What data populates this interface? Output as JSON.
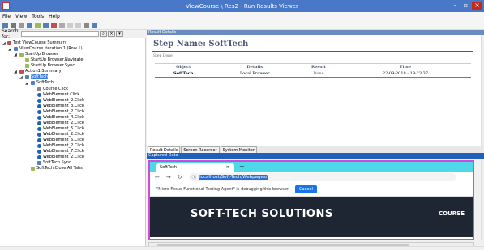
{
  "window": {
    "title": "ViewCourse \\ Res2 - Run Results Viewer"
  },
  "menu": [
    "File",
    "View",
    "Tools",
    "Help"
  ],
  "search": {
    "label": "Search for:"
  },
  "tree": [
    {
      "label": "Test ViewCourse Summary",
      "icon": "summary-icon",
      "color": "#c0504d"
    },
    {
      "label": "ViewCourse Iteration 1 (Row 1)",
      "icon": "iteration-icon",
      "color": "#4f81bd"
    },
    {
      "label": "StartUp Browser",
      "icon": "action-icon",
      "color": "#9bbb59"
    },
    {
      "label": "StartUp Browser.Navigate",
      "icon": "step-icon",
      "color": "#9bbb59"
    },
    {
      "label": "StartUp Browser.Sync",
      "icon": "step-icon",
      "color": "#9bbb59"
    },
    {
      "label": "Action1 Summary",
      "icon": "action-icon",
      "color": "#c0504d"
    },
    {
      "label": "SoftTech",
      "icon": "browser-icon",
      "color": "#4f81bd"
    },
    {
      "label": "SoftTech",
      "icon": "page-icon",
      "color": "#4f81bd"
    },
    {
      "label": "Course.Click",
      "icon": "link-icon",
      "color": "#888888"
    },
    {
      "label": "WebElement.Click",
      "icon": "web-element-icon",
      "color": "#1f5fbf"
    },
    {
      "label": "WebElement_2.Click",
      "icon": "web-element-icon",
      "color": "#1f5fbf"
    },
    {
      "label": "WebElement_3.Click",
      "icon": "web-element-icon",
      "color": "#1f5fbf"
    },
    {
      "label": "WebElement_2.Click",
      "icon": "web-element-icon",
      "color": "#1f5fbf"
    },
    {
      "label": "WebElement_4.Click",
      "icon": "web-element-icon",
      "color": "#1f5fbf"
    },
    {
      "label": "WebElement_2.Click",
      "icon": "web-element-icon",
      "color": "#1f5fbf"
    },
    {
      "label": "WebElement_5.Click",
      "icon": "web-element-icon",
      "color": "#1f5fbf"
    },
    {
      "label": "WebElement_2.Click",
      "icon": "web-element-icon",
      "color": "#1f5fbf"
    },
    {
      "label": "WebElement_6.Click",
      "icon": "web-element-icon",
      "color": "#1f5fbf"
    },
    {
      "label": "WebElement_2.Click",
      "icon": "web-element-icon",
      "color": "#1f5fbf"
    },
    {
      "label": "WebElement_7.Click",
      "icon": "web-element-icon",
      "color": "#1f5fbf"
    },
    {
      "label": "WebElement_2.Click",
      "icon": "web-element-icon",
      "color": "#1f5fbf"
    },
    {
      "label": "SoftTech.Sync",
      "icon": "page-icon",
      "color": "#4f81bd"
    },
    {
      "label": "SoftTech.Close All Tabs",
      "icon": "step-icon",
      "color": "#9bbb59"
    }
  ],
  "result_details": {
    "panel_title": "Result Details",
    "step_name": "Step Name: SoftTech",
    "step_status": "Step Done",
    "columns": [
      "Object",
      "Details",
      "Result",
      "Time"
    ],
    "rows": [
      {
        "object": "SoftTech",
        "details": "Local Browser",
        "result": "Done",
        "time": "22-09-2018 - 19:23:37"
      }
    ]
  },
  "tabs": [
    "Result Details",
    "Screen Recorder",
    "System Monitor"
  ],
  "captured": {
    "panel_title": "Captured Data",
    "browser_tab": "SoftTech",
    "url": "localhost/Soft-Tech/Webpages/",
    "info_text": "\"Micro Focus Functional Testing Agent\" is debugging this browser",
    "cancel_label": "Cancel",
    "banner_title": "SOFT-TECH SOLUTIONS",
    "banner_link": "COURSE"
  }
}
